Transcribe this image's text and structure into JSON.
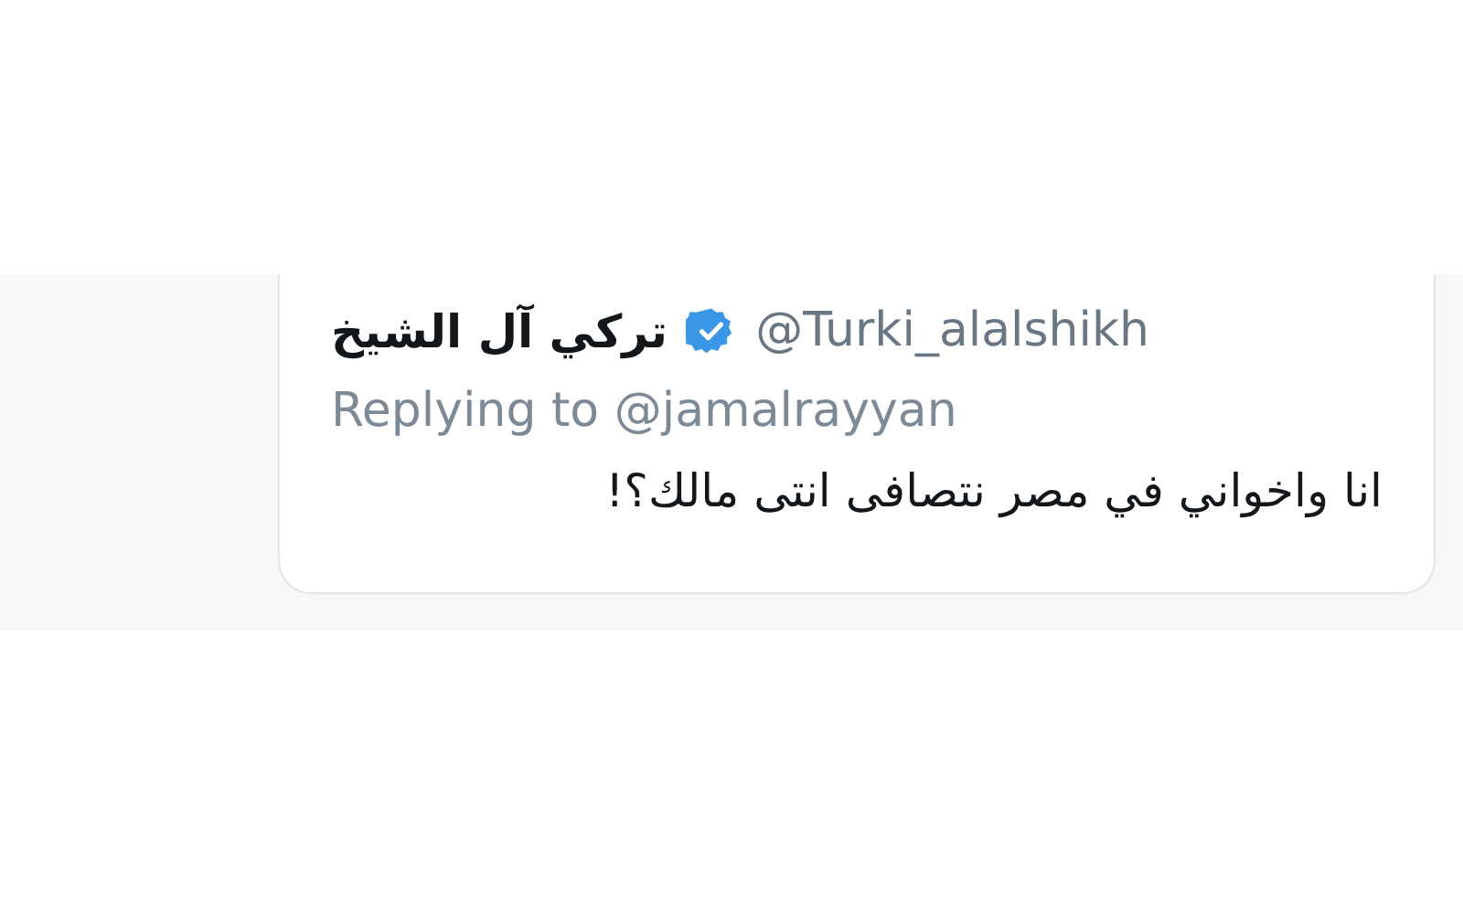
{
  "tweet": {
    "display_name": "تركي آل الشيخ",
    "verified": true,
    "handle": "@Turki_alalshikh",
    "reply_to": "Replying to @jamalrayyan",
    "text": "انا واخواني في مصر نتصافى انتى مالك؟!"
  }
}
